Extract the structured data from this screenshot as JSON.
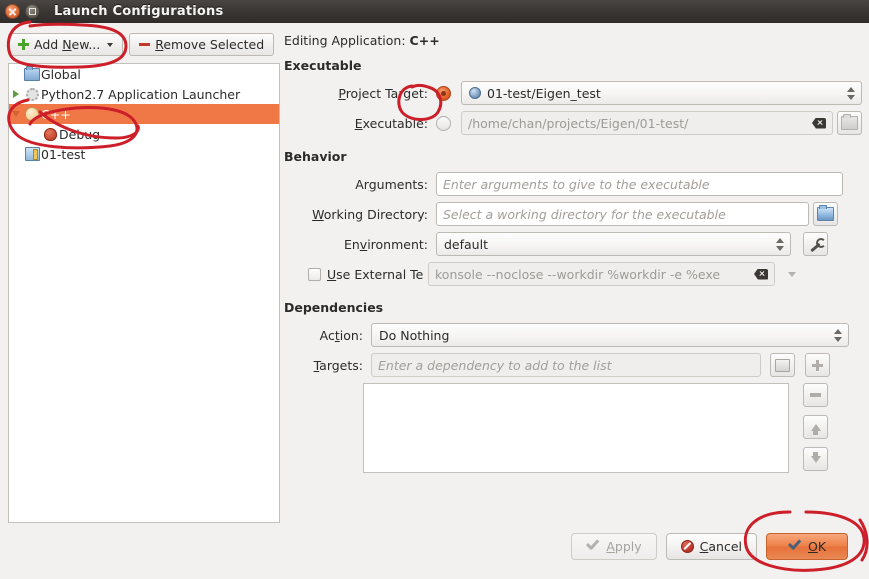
{
  "window": {
    "title": "Launch Configurations",
    "close_icon": "close-icon",
    "maximize_icon": "maximize-icon"
  },
  "toolbar": {
    "add_new_label": "Add New...",
    "add_new_icon": "plus-icon",
    "remove_selected_label": "Remove Selected",
    "remove_selected_icon": "minus-icon"
  },
  "tree": {
    "items": [
      {
        "label": "Global",
        "icon": "folder-icon",
        "indent": 1,
        "twisty": "none",
        "selected": false
      },
      {
        "label": "Python2.7 Application Launcher",
        "icon": "gear-icon",
        "indent": 1,
        "twisty": "collapsed",
        "selected": false
      },
      {
        "label": "C++",
        "icon": "bug-icon",
        "indent": 1,
        "twisty": "expanded",
        "selected": true
      },
      {
        "label": "Debug",
        "icon": "bug-red-icon",
        "indent": 2,
        "twisty": "none",
        "selected": false
      },
      {
        "label": "01-test",
        "icon": "project-icon",
        "indent": 1,
        "twisty": "none",
        "selected": false
      }
    ]
  },
  "main": {
    "editing_prefix": "Editing Application: ",
    "editing_value": "C++",
    "executable_group": "Executable",
    "project_target_label": "Project Target:",
    "project_target_value": "01-test/Eigen_test",
    "project_target_selected": true,
    "executable_label": "Executable:",
    "executable_value": "/home/chan/projects/Eigen/01-test/",
    "executable_selected": false,
    "behavior_group": "Behavior",
    "arguments_label": "Arguments:",
    "arguments_placeholder": "Enter arguments to give to the executable",
    "working_dir_label": "Working Directory:",
    "working_dir_placeholder": "Select a working directory for the executable",
    "environment_label": "Environment:",
    "environment_value": "default",
    "use_external_label": "Use External Te",
    "use_external_checked": false,
    "external_terminal_value": "konsole --noclose --workdir %workdir -e %exe",
    "dependencies_group": "Dependencies",
    "action_label": "Action:",
    "action_value": "Do Nothing",
    "targets_label": "Targets:",
    "targets_placeholder": "Enter a dependency to add to the list",
    "targets_list": [],
    "side_buttons": [
      "add-icon",
      "remove-icon",
      "move-up-icon",
      "move-down-icon"
    ]
  },
  "footer": {
    "apply_label": "Apply",
    "apply_enabled": false,
    "cancel_label": "Cancel",
    "ok_label": "OK",
    "ok_highlighted": true
  },
  "colors": {
    "selection": "#f07746",
    "primary_button": "#ee8049",
    "annotation_ink": "#cc1f2a",
    "titlebar": "#3a3633"
  }
}
